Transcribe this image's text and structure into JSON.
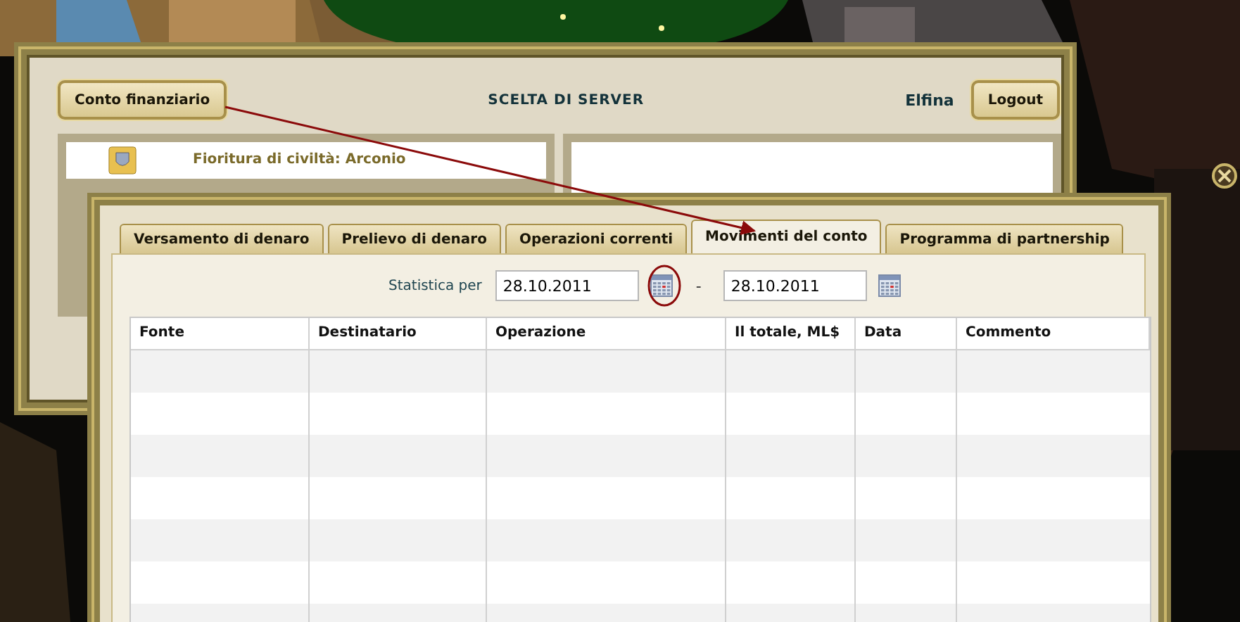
{
  "back_window": {
    "account_button": "Conto finanziario",
    "title": "SCELTA DI SERVER",
    "username": "Elfina",
    "logout_button": "Logout",
    "server_card": {
      "name": "Fioritura di civiltà: Arconio"
    }
  },
  "dialog": {
    "tabs": [
      {
        "label": "Versamento di denaro",
        "selected": false
      },
      {
        "label": "Prelievo di denaro",
        "selected": false
      },
      {
        "label": "Operazioni correnti",
        "selected": false
      },
      {
        "label": "Movimenti del conto",
        "selected": true
      },
      {
        "label": "Programma di partnership",
        "selected": false
      }
    ],
    "filter": {
      "label": "Statistica per",
      "from": "28.10.2011",
      "separator": "-",
      "to": "28.10.2011"
    },
    "table": {
      "columns": [
        "Fonte",
        "Destinatario",
        "Operazione",
        "Il totale, ML$",
        "Data",
        "Commento"
      ]
    }
  }
}
